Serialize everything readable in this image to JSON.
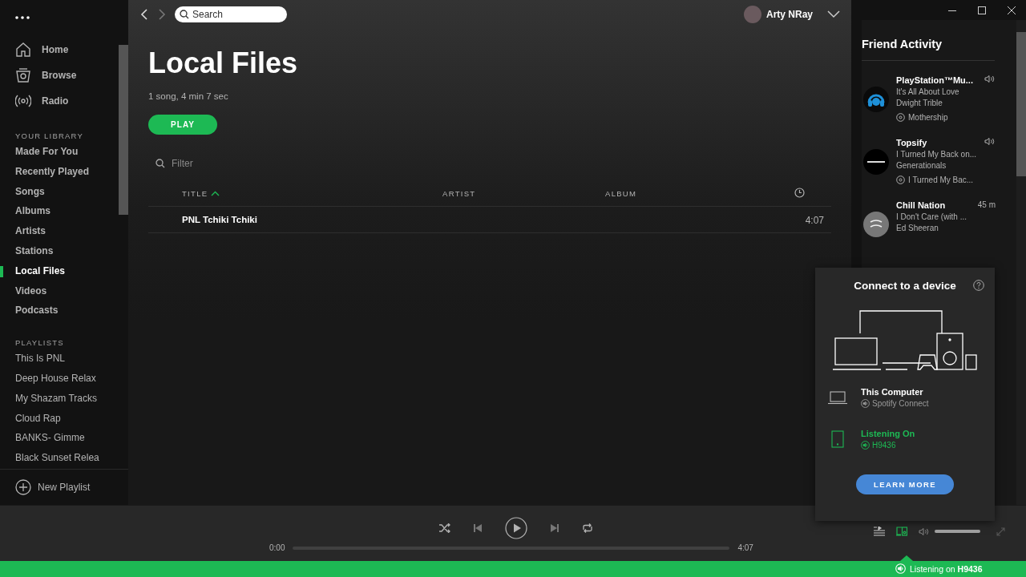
{
  "sidebar": {
    "nav": [
      {
        "label": "Home",
        "selected": false
      },
      {
        "label": "Browse",
        "selected": false
      },
      {
        "label": "Radio",
        "selected": false
      }
    ],
    "library_heading": "YOUR LIBRARY",
    "library": [
      {
        "label": "Made For You",
        "selected": false
      },
      {
        "label": "Recently Played",
        "selected": false
      },
      {
        "label": "Songs",
        "selected": false
      },
      {
        "label": "Albums",
        "selected": false
      },
      {
        "label": "Artists",
        "selected": false
      },
      {
        "label": "Stations",
        "selected": false
      },
      {
        "label": "Local Files",
        "selected": true
      },
      {
        "label": "Videos",
        "selected": false
      },
      {
        "label": "Podcasts",
        "selected": false
      }
    ],
    "playlists_heading": "PLAYLISTS",
    "playlists": [
      {
        "label": "This Is PNL",
        "selected": false
      },
      {
        "label": "Deep House Relax",
        "selected": false
      },
      {
        "label": "My Shazam Tracks",
        "selected": false
      },
      {
        "label": "Cloud Rap",
        "selected": false
      },
      {
        "label": "BANKS- Gimme",
        "selected": false
      },
      {
        "label": "Black Sunset Relea",
        "selected": false
      }
    ],
    "new_playlist": "New Playlist"
  },
  "topbar": {
    "search_placeholder": "Search",
    "user_name": "Arty NRay"
  },
  "page": {
    "title": "Local Files",
    "summary": "1 song, 4 min 7 sec",
    "play_button": "PLAY",
    "filter_placeholder": "Filter",
    "columns": [
      {
        "label": "TITLE",
        "sorted": true
      },
      {
        "label": "ARTIST",
        "sorted": false
      },
      {
        "label": "ALBUM",
        "sorted": false
      }
    ],
    "rows": [
      {
        "title": "PNL Tchiki Tchiki",
        "duration": "4:07"
      }
    ]
  },
  "friend_activity": {
    "title": "Friend Activity",
    "friends": [
      {
        "name": "PlayStation™Mu...",
        "track": "It's All About Love",
        "artist": "Dwight Trible",
        "context": "Mothership",
        "playing": true
      },
      {
        "name": "Topsify",
        "track": "I Turned My Back on...",
        "artist": "Generationals",
        "context": "I Turned My Bac...",
        "playing": true
      },
      {
        "name": "Chill Nation",
        "time": "45 m",
        "track": "I Don't Care (with ...",
        "artist": "Ed Sheeran",
        "playing": false
      }
    ]
  },
  "device_popup": {
    "title": "Connect to a device",
    "devices": [
      {
        "name": "This Computer",
        "subtitle": "Spotify Connect",
        "active": false
      },
      {
        "name": "Listening On",
        "subtitle": "H9436",
        "active": true
      }
    ],
    "button": "LEARN MORE"
  },
  "player": {
    "elapsed": "0:00",
    "total": "4:07",
    "progress": {
      "level": 0
    },
    "volume": {
      "level": 1
    }
  },
  "status_bar": {
    "text": "Listening on **H9436**"
  }
}
